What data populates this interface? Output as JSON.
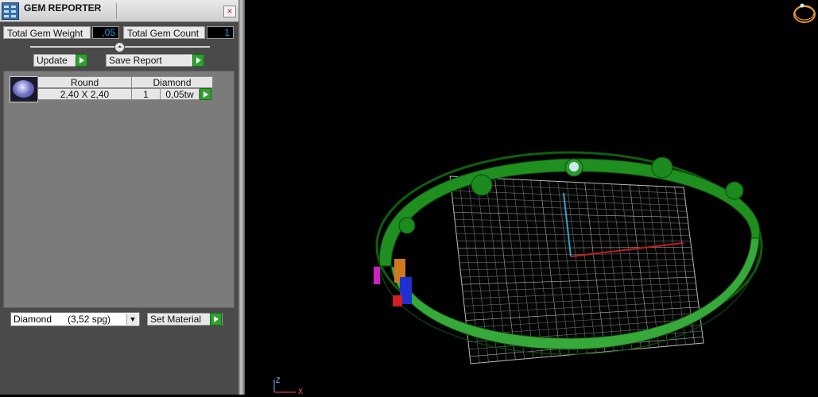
{
  "window": {
    "title": "GEM REPORTER",
    "close_glyph": "×"
  },
  "totals": {
    "weight_label": "Total Gem Weight",
    "weight_value": ",05",
    "count_label": "Total Gem Count",
    "count_value": "1"
  },
  "slider_glyph": "⏶",
  "buttons": {
    "update": "Update",
    "save_report": "Save Report",
    "set_material": "Set Material"
  },
  "gem_list": {
    "headers": {
      "shape": "Round",
      "material": "Diamond"
    },
    "rows": [
      {
        "size": "2,40 X 2,40",
        "count": "1",
        "weight": "0,05tw"
      }
    ]
  },
  "material_select": {
    "value": "Diamond      (3,52 spg)",
    "dropdown_glyph": "▼"
  },
  "viewport": {
    "axis_z_label": "Z",
    "axis_x_label": "X",
    "ring_color": "#1f8a1f",
    "grid_color": "#9a9a9a"
  }
}
